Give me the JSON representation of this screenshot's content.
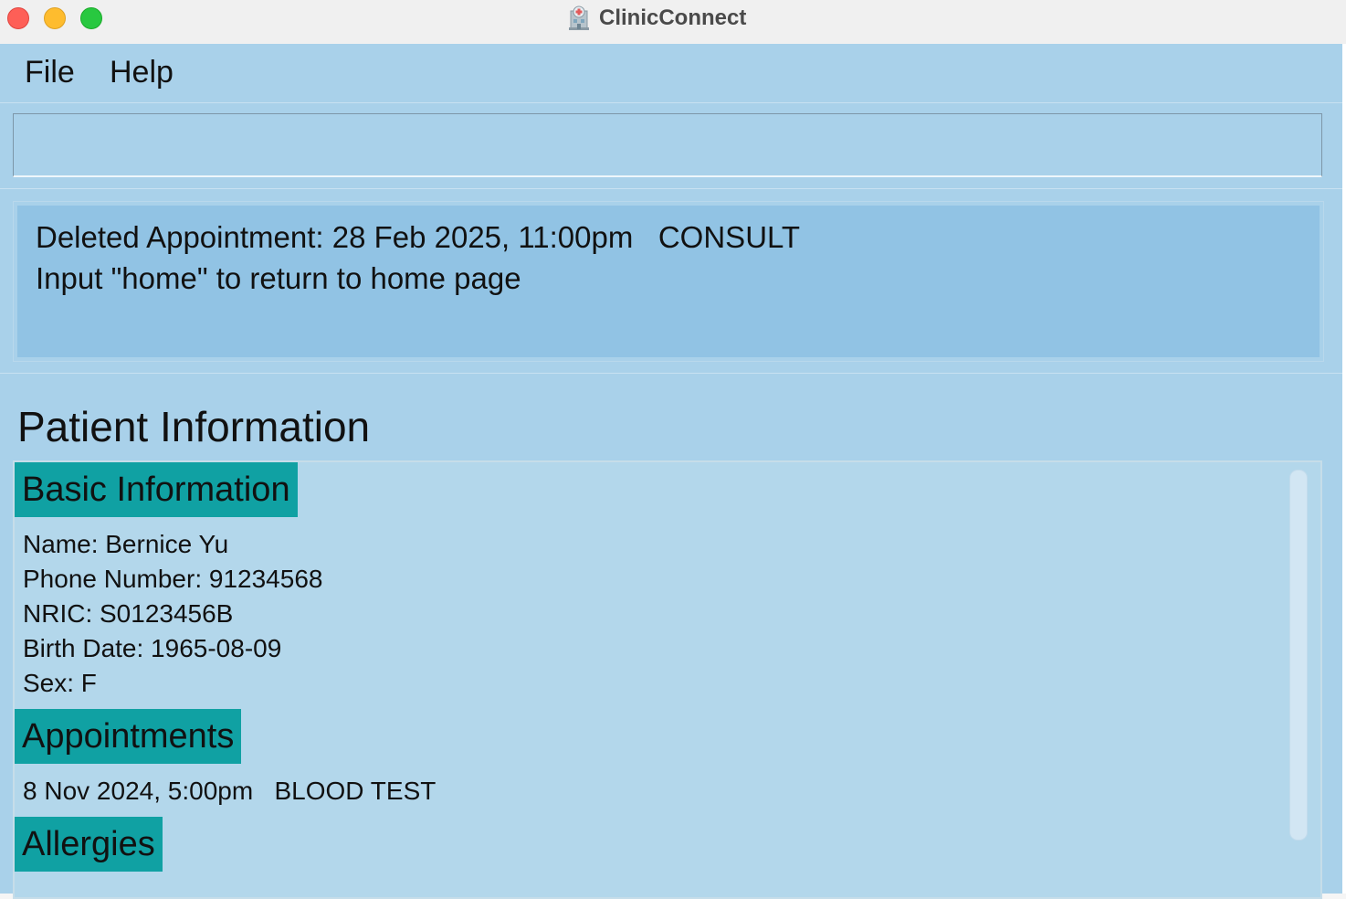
{
  "window": {
    "title": "ClinicConnect"
  },
  "menu": {
    "file": "File",
    "help": "Help"
  },
  "command_box": {
    "value": ""
  },
  "result": {
    "line1": "Deleted Appointment: 28 Feb 2025, 11:00pm   CONSULT",
    "line2": "Input \"home\" to return to home page"
  },
  "patient": {
    "title": "Patient Information",
    "basic_header": "Basic Information",
    "name": "Name: Bernice Yu",
    "phone": "Phone Number: 91234568",
    "nric": "NRIC: S0123456B",
    "birth_date": "Birth Date: 1965-08-09",
    "sex": "Sex: F",
    "appointments_header": "Appointments",
    "appointments": [
      "8 Nov 2024, 5:00pm   BLOOD TEST"
    ],
    "allergies_header": "Allergies"
  },
  "colors": {
    "window_bg": "#a9d1ea",
    "result_bg": "#91c3e4",
    "panel_bg": "#b3d7eb",
    "section_header": "#10a1a3"
  }
}
